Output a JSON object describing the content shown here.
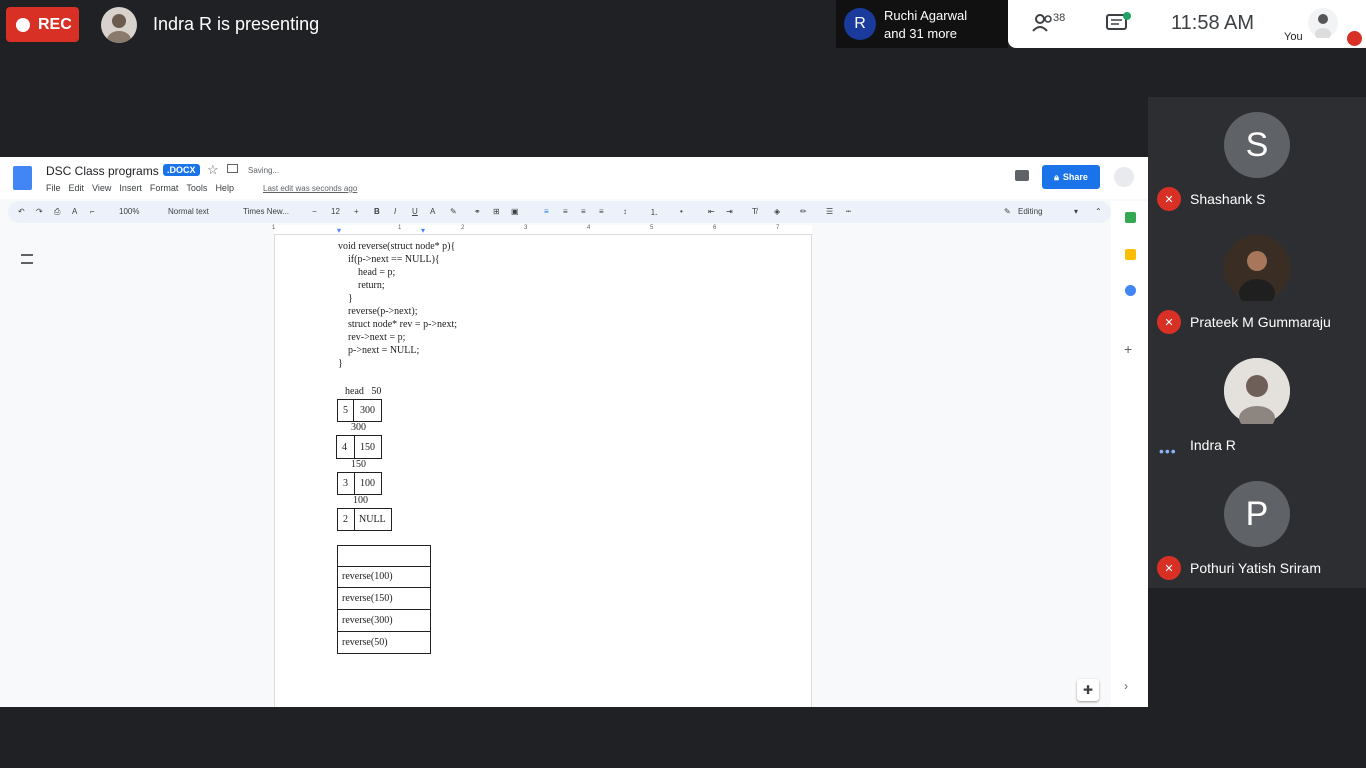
{
  "meet": {
    "rec_label": "REC",
    "presenting_text": "Indra R is presenting",
    "ruchi_name": "Ruchi Agarwal",
    "ruchi_more": "and 31 more",
    "ruchi_initial": "R",
    "people_count": "38",
    "time": "11:58  AM",
    "you_label": "You"
  },
  "docs": {
    "title": "DSC Class programs",
    "badge": ".DOCX",
    "saving": "Saving...",
    "menu": [
      "File",
      "Edit",
      "View",
      "Insert",
      "Format",
      "Tools",
      "Help"
    ],
    "last_edit": "Last edit was seconds ago",
    "share_label": "Share",
    "zoom": "100%",
    "style": "Normal text",
    "font": "Times New...",
    "font_size": "12",
    "mode": "Editing",
    "ruler_marks": [
      "1",
      "1",
      "2",
      "3",
      "4",
      "5",
      "6",
      "7"
    ]
  },
  "document": {
    "code_lines": [
      "void reverse(struct node* p){",
      "    if(p->next == NULL){",
      "        head = p;",
      "        return;",
      "    }",
      "    reverse(p->next);",
      "    struct node* rev = p->next;",
      "    rev->next = p;",
      "    p->next = NULL;",
      "}"
    ],
    "head_label": "head   50",
    "nodes": [
      {
        "data": "5",
        "next": "300",
        "addr_below": "300"
      },
      {
        "data": "4",
        "next": "150",
        "addr_below": "150"
      },
      {
        "data": "3",
        "next": "100",
        "addr_below": "100"
      },
      {
        "data": "2",
        "next": "NULL",
        "addr_below": ""
      }
    ],
    "stack": [
      "",
      "reverse(100)",
      "reverse(150)",
      "reverse(300)",
      "reverse(50)"
    ]
  },
  "participants": [
    {
      "name": "Shashank S",
      "initial": "S",
      "color": "#5f6368",
      "muted": true
    },
    {
      "name": "Prateek M Gummaraju",
      "initial": "",
      "color": "#4a3a2a",
      "muted": true
    },
    {
      "name": "Indra R",
      "initial": "",
      "color": "#d7d2cd",
      "muted": false
    },
    {
      "name": "Pothuri Yatish Sriram",
      "initial": "P",
      "color": "#5f6368",
      "muted": true
    }
  ]
}
